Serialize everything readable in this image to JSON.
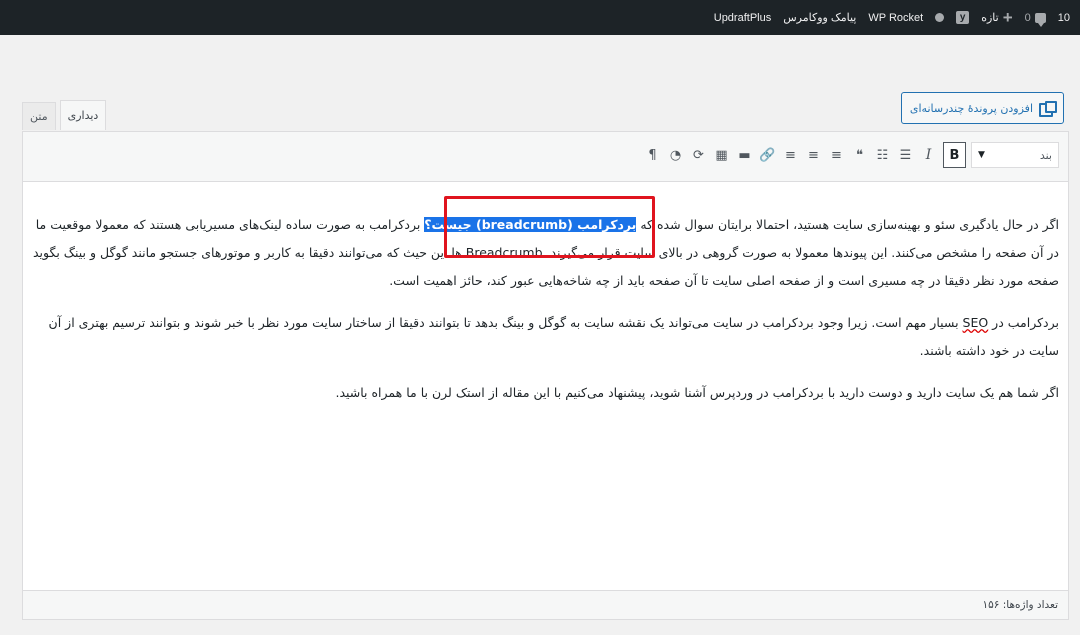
{
  "admin_bar": {
    "items": [
      {
        "name": "updraftplus",
        "label": "UpdraftPlus"
      },
      {
        "name": "sms-woocommerce",
        "label": "پیامک ووکامرس"
      },
      {
        "name": "wp-rocket",
        "label": "WP Rocket"
      },
      {
        "name": "new",
        "label": "تازه"
      },
      {
        "name": "comments",
        "count": "0"
      },
      {
        "name": "updates",
        "count": "10"
      }
    ],
    "icons": [
      "dot-icon",
      "yoast-icon",
      "plus-icon",
      "comment-icon"
    ]
  },
  "editor": {
    "add_media_label": "افزودن پروندهٔ چندرسانه‌ای",
    "tabs": [
      {
        "label": "دیداری",
        "active": true
      },
      {
        "label": "متن",
        "active": false
      }
    ],
    "format_select": {
      "value": "بند"
    },
    "toolbar_buttons": [
      {
        "name": "bold",
        "glyph": "B"
      },
      {
        "name": "italic",
        "glyph": "I"
      },
      {
        "name": "bullet-list",
        "glyph": "☰"
      },
      {
        "name": "numbered-list",
        "glyph": "☷"
      },
      {
        "name": "blockquote",
        "glyph": "❝"
      },
      {
        "name": "align-left",
        "glyph": "≡"
      },
      {
        "name": "align-center",
        "glyph": "≡"
      },
      {
        "name": "align-right",
        "glyph": "≡"
      },
      {
        "name": "link",
        "glyph": "🔗"
      },
      {
        "name": "read-more",
        "glyph": "▬"
      },
      {
        "name": "toolbar-toggle",
        "glyph": "▦"
      },
      {
        "name": "refresh",
        "glyph": "⟳"
      },
      {
        "name": "pie",
        "glyph": "◔"
      },
      {
        "name": "paragraph-direction",
        "glyph": "¶"
      }
    ],
    "content": {
      "p1_highlight": "بردکرامب (breadcrumb) جیست؟",
      "p1_before": "اگر در حال یادگیری سئو و بهینه‌سازی سایت هستید، احتمالا برایتان سوال شده که ",
      "p1_after": " بردکرامب به صورت ساده لینک‌های مسیریابی هستند که معمولا موقعیت ما در آن صفحه را مشخص می‌کنند. این پیوندها معمولا به صورت گروهی در بالای سایت قرار می‌گیرند. Breadcrumb ها این حیث که می‌توانند دقیقا به کاربر و موتورهای جستجو مانند گوگل و بینگ بگوید صفحه مورد نظر دقیقا در چه مسیری است و از صفحه اصلی سایت تا آن صفحه باید از چه شاخه‌هایی عبور کند، حائز اهمیت است.",
      "p2_before": "بردکرامب در ",
      "p2_seo": "SEO",
      "p2_after": " بسیار مهم است. زیرا وجود بردکرامب در سایت می‌تواند یک نقشه سایت به گوگل و بینگ بدهد تا بتوانند دقیقا از ساختار سایت مورد نظر با خبر شوند و بتوانند ترسیم بهتری از آن سایت در خود داشته باشند.",
      "p3": "اگر شما هم یک سایت دارید و دوست دارید با بردکرامب در وردپرس آشنا شوید، پیشنهاد می‌کنیم با این مقاله از استک لرن با ما همراه باشید."
    },
    "word_count": "تعداد واژه‌ها: ۱۵۶"
  }
}
